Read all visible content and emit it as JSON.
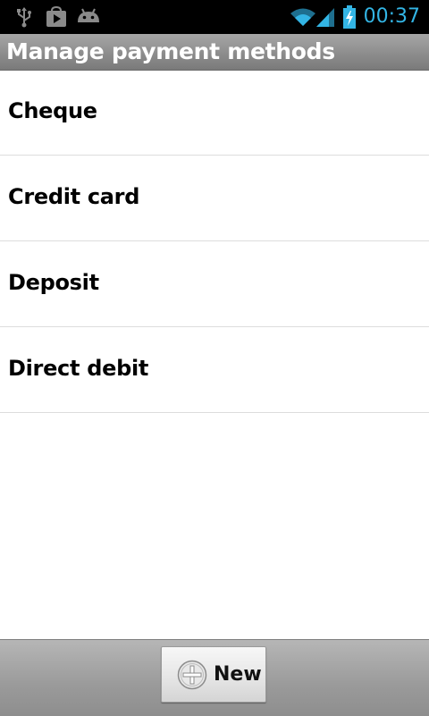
{
  "status_bar": {
    "time": "00:37",
    "icons": [
      "usb-icon",
      "play-store-icon",
      "android-icon",
      "wifi-icon",
      "signal-icon",
      "battery-charging-icon"
    ],
    "accent_color": "#33b5e5"
  },
  "title_bar": {
    "title": "Manage payment methods"
  },
  "payment_methods": {
    "items": [
      {
        "label": "Cheque"
      },
      {
        "label": "Credit card"
      },
      {
        "label": "Deposit"
      },
      {
        "label": "Direct debit"
      }
    ]
  },
  "bottom_bar": {
    "new_button": {
      "label": "New",
      "icon": "plus-circle-icon"
    }
  }
}
